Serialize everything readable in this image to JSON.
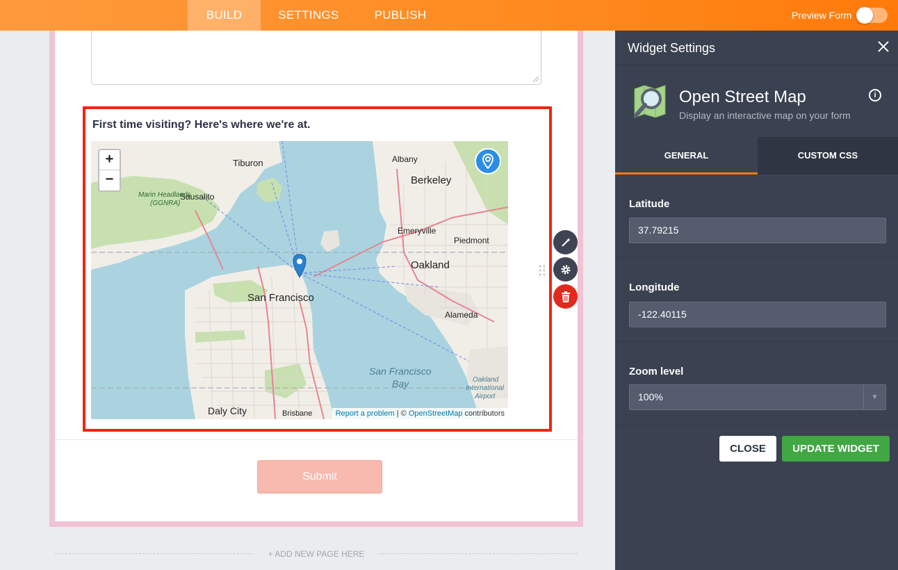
{
  "topbar": {
    "tabs": [
      "BUILD",
      "SETTINGS",
      "PUBLISH"
    ],
    "preview_label": "Preview Form"
  },
  "form": {
    "map_question": "First time visiting? Here's where we're at.",
    "submit_label": "Submit",
    "add_page_label": "+ ADD NEW PAGE HERE"
  },
  "map": {
    "zoom_in": "+",
    "zoom_out": "−",
    "attribution": {
      "report": "Report a problem",
      "sep": " | © ",
      "osm": "OpenStreetMap",
      "contributors": " contributors"
    },
    "places": {
      "tiburon": "Tiburon",
      "albany": "Albany",
      "berkeley": "Berkeley",
      "marin": "Marin Headlands",
      "ggnra": "(GGNRA)",
      "sausalito": "Sausalito",
      "emeryville": "Emeryville",
      "piedmont": "Piedmont",
      "oakland": "Oakland",
      "sf": "San Francisco",
      "alameda": "Alameda",
      "sfbay1": "San Francisco",
      "sfbay2": "Bay",
      "airport1": "Oakland",
      "airport2": "International",
      "airport3": "Airport",
      "daly": "Daly City",
      "brisbane": "Brisbane"
    }
  },
  "panel": {
    "title": "Widget Settings",
    "widget_name": "Open Street Map",
    "widget_desc": "Display an interactive map on your form",
    "tabs": [
      "GENERAL",
      "CUSTOM CSS"
    ],
    "latitude_label": "Latitude",
    "latitude_value": "37.79215",
    "longitude_label": "Longitude",
    "longitude_value": "-122.40115",
    "zoom_label": "Zoom level",
    "zoom_value": "100%",
    "close_label": "CLOSE",
    "update_label": "UPDATE WIDGET"
  },
  "colors": {
    "accent": "#ff7a0a",
    "selection": "#f0250f",
    "update": "#40a743",
    "delete": "#e3281e"
  }
}
